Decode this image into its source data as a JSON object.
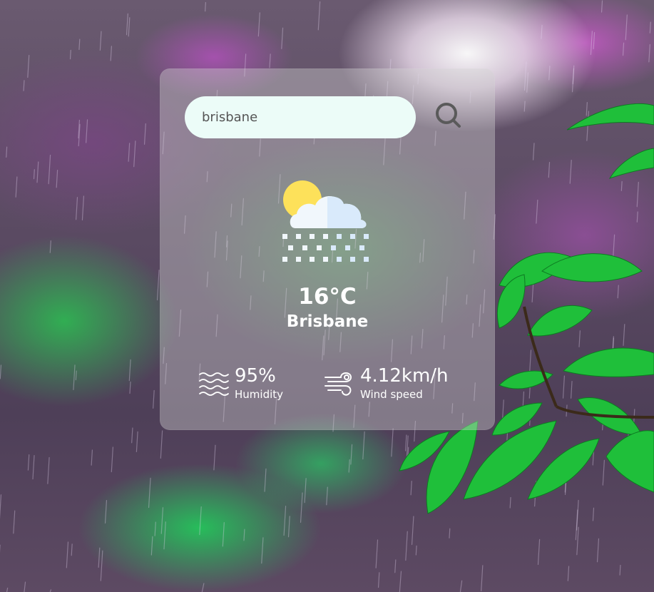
{
  "search": {
    "value": "brisbane",
    "placeholder": "",
    "button_icon": "search-icon"
  },
  "weather": {
    "icon": "sun-cloud-snow-icon",
    "temperature": "16°C",
    "city": "Brisbane"
  },
  "details": {
    "humidity": {
      "icon": "humidity-waves-icon",
      "value": "95%",
      "label": "Humidity"
    },
    "wind": {
      "icon": "wind-icon",
      "value": "4.12km/h",
      "label": "Wind speed"
    }
  },
  "colors": {
    "input_background": "#ecfcf8",
    "text": "#ffffff",
    "sun": "#fde15a",
    "cloud": "#f1f7fc",
    "cloud_shade": "#d9eafb"
  }
}
